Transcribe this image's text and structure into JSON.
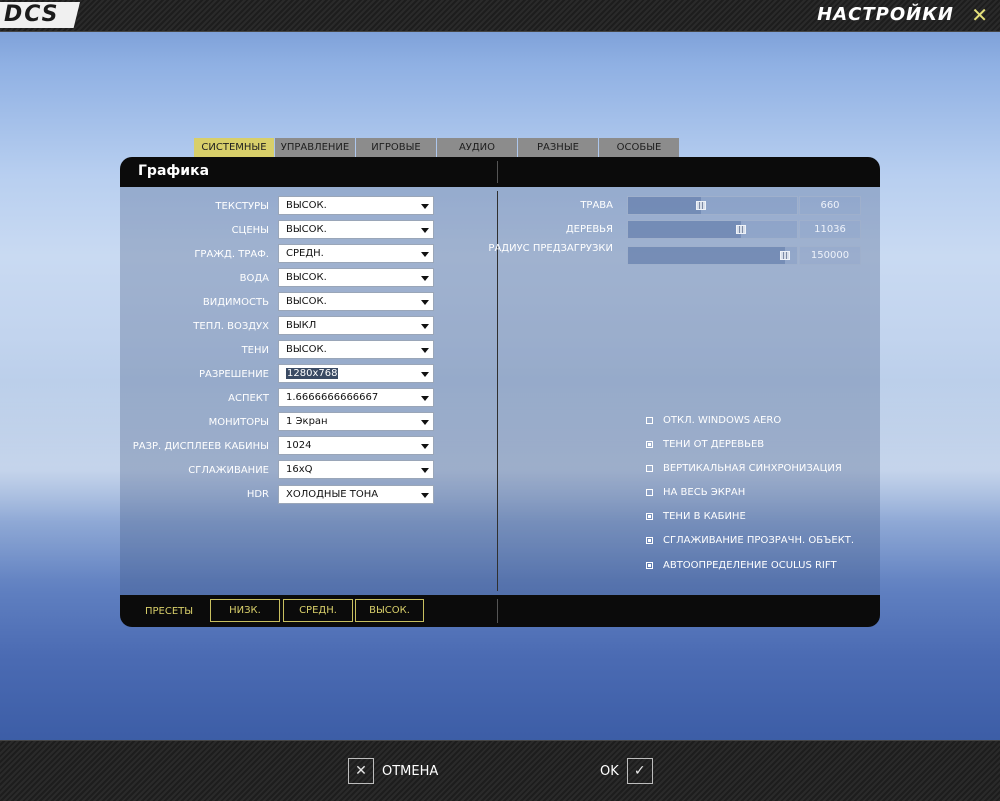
{
  "header": {
    "logo": "DCS",
    "title": "НАСТРОЙКИ",
    "close": "✕"
  },
  "tabs": [
    {
      "label": "СИСТЕМНЫЕ",
      "active": true
    },
    {
      "label": "УПРАВЛЕНИЕ",
      "active": false
    },
    {
      "label": "ИГРОВЫЕ",
      "active": false
    },
    {
      "label": "АУДИО",
      "active": false
    },
    {
      "label": "РАЗНЫЕ",
      "active": false
    },
    {
      "label": "ОСОБЫЕ",
      "active": false
    }
  ],
  "panel": {
    "title": "Графика",
    "settings": [
      {
        "label": "ТЕКСТУРЫ",
        "value": "ВЫСОК."
      },
      {
        "label": "СЦЕНЫ",
        "value": "ВЫСОК."
      },
      {
        "label": "ГРАЖД. ТРАФ.",
        "value": "СРЕДН."
      },
      {
        "label": "ВОДА",
        "value": "ВЫСОК."
      },
      {
        "label": "ВИДИМОСТЬ",
        "value": "ВЫСОК."
      },
      {
        "label": "ТЕПЛ. ВОЗДУХ",
        "value": "ВЫКЛ"
      },
      {
        "label": "ТЕНИ",
        "value": "ВЫСОК."
      },
      {
        "label": "РАЗРЕШЕНИЕ",
        "value": "1280x768"
      },
      {
        "label": "АСПЕКТ",
        "value": "1.6666666666667"
      },
      {
        "label": "МОНИТОРЫ",
        "value": "1 Экран"
      },
      {
        "label": "РАЗР. ДИСПЛЕЕВ КАБИНЫ",
        "value": "1024"
      },
      {
        "label": "СГЛАЖИВАНИЕ",
        "value": "16xQ"
      },
      {
        "label": "HDR",
        "value": "ХОЛОДНЫЕ ТОНА"
      }
    ],
    "sliders": [
      {
        "label": "ТРАВА",
        "value": "660",
        "level": 0.43
      },
      {
        "label": "ДЕРЕВЬЯ",
        "value": "11036",
        "level": 0.67
      },
      {
        "label": "РАДИУС ПРЕДЗАГРУЗКИ",
        "value": "150000",
        "level": 0.93
      }
    ],
    "checkboxes": [
      {
        "label": "ОТКЛ. WINDOWS AERO",
        "checked": false
      },
      {
        "label": "ТЕНИ ОТ ДЕРЕВЬЕВ",
        "checked": true
      },
      {
        "label": "ВЕРТИКАЛЬНАЯ СИНХРОНИЗАЦИЯ",
        "checked": false
      },
      {
        "label": "НА ВЕСЬ ЭКРАН",
        "checked": false
      },
      {
        "label": "ТЕНИ В КАБИНЕ",
        "checked": true
      },
      {
        "label": "СГЛАЖИВАНИЕ ПРОЗРАЧН. ОБЪЕКТ.",
        "checked": true
      },
      {
        "label": "АВТООПРЕДЕЛЕНИЕ OCULUS RIFT",
        "checked": true
      }
    ],
    "presets": {
      "label": "ПРЕСЕТЫ",
      "buttons": [
        "НИЗК.",
        "СРЕДН.",
        "ВЫСОК."
      ]
    }
  },
  "footer": {
    "cancel_label": "ОТМЕНА",
    "ok_label": "OK",
    "cancel_icon": "✕",
    "ok_icon": "✓"
  }
}
